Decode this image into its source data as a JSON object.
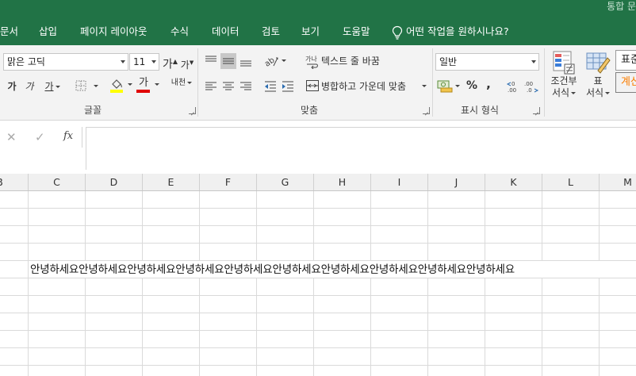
{
  "titlebar": {
    "right_text": "통합 문"
  },
  "menu": {
    "tabs": [
      {
        "label": "문서"
      },
      {
        "label": "삽입"
      },
      {
        "label": "페이지 레이아웃"
      },
      {
        "label": "수식"
      },
      {
        "label": "데이터"
      },
      {
        "label": "검토"
      },
      {
        "label": "보기"
      },
      {
        "label": "도움말"
      }
    ],
    "tell_me": "어떤 작업을 원하시나요?"
  },
  "ribbon": {
    "font": {
      "name": "맑은 고딕",
      "size": "11",
      "grow_label": "가",
      "shrink_label": "가",
      "bold_label": "가",
      "italic_label": "가",
      "underline_label": "가",
      "font_color_label": "가",
      "phonetic_label": "내천",
      "group_label": "글꼴"
    },
    "alignment": {
      "wrap_label": "텍스트 줄 바꿈",
      "merge_label": "병합하고 가운데 맞춤",
      "group_label": "맞춤"
    },
    "number": {
      "format": "일반",
      "percent": "%",
      "comma": ",",
      "group_label": "표시 형식"
    },
    "styles": {
      "conditional_line1": "조건부",
      "conditional_line2": "서식",
      "table_line1": "표",
      "table_line2": "서식",
      "style_normal": "표준",
      "style_calc": "계산"
    }
  },
  "formula_bar": {
    "cancel": "✕",
    "enter": "✓",
    "fx": "fx",
    "value": ""
  },
  "sheet": {
    "columns": [
      "B",
      "C",
      "D",
      "E",
      "F",
      "G",
      "H",
      "I",
      "J",
      "K",
      "L",
      "M"
    ],
    "cell_text": "안녕하세요안녕하세요안녕하세요안녕하세요안녕하세요안녕하세요안녕하세요안녕하세요안녕하세요안녕하세요"
  }
}
